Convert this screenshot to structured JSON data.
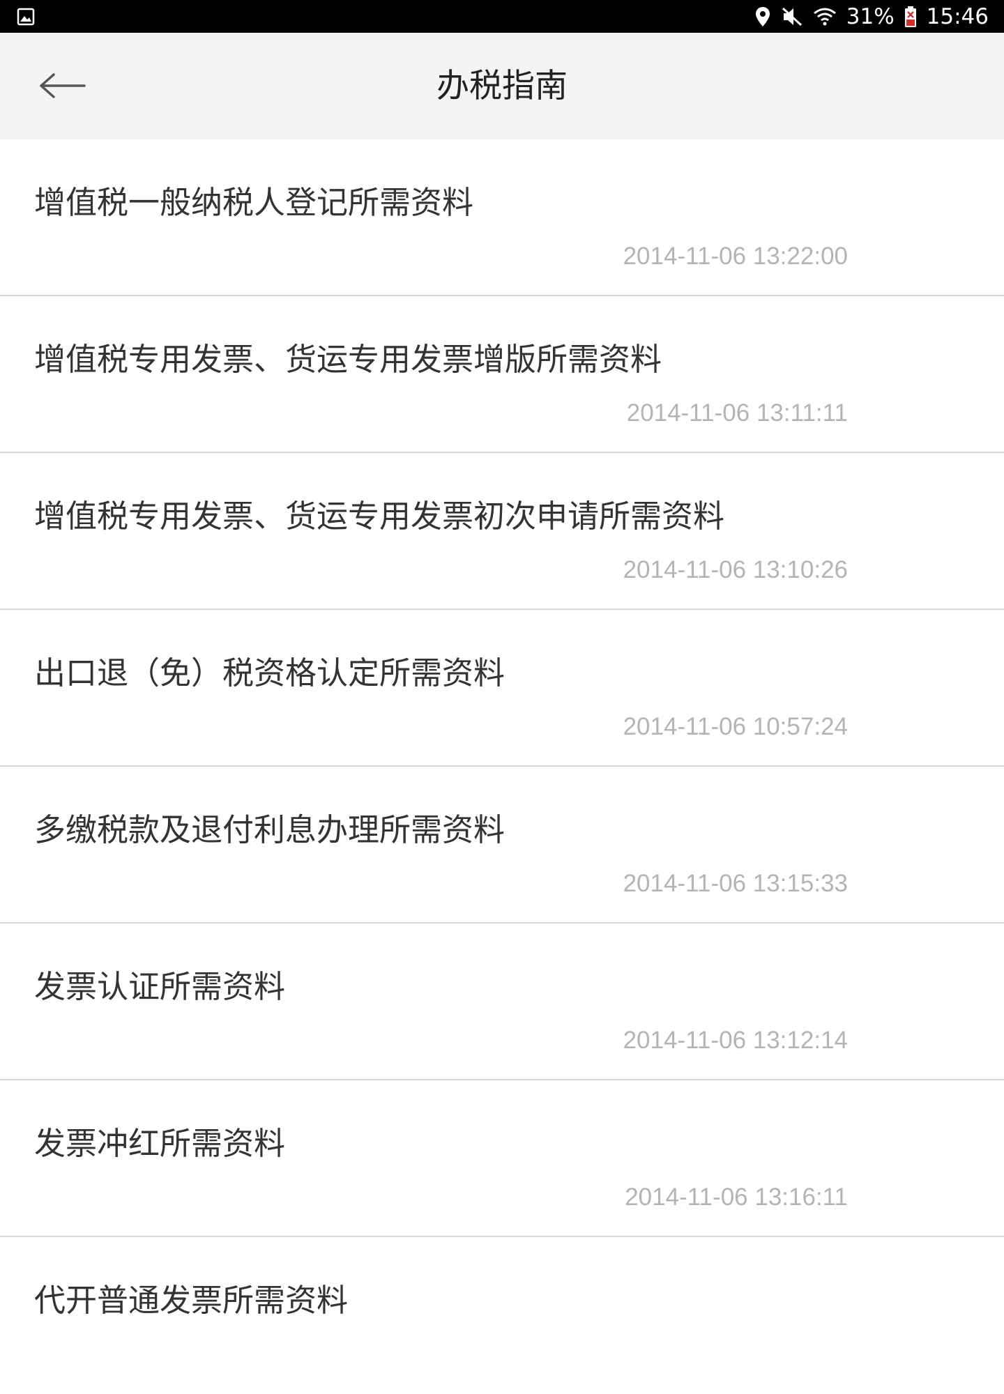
{
  "status_bar": {
    "left_icon": "image-notification-icon",
    "icons": [
      "location-icon",
      "mute-icon",
      "wifi-icon",
      "battery-icon"
    ],
    "battery_percent": "31%",
    "time": "15:46"
  },
  "header": {
    "back_icon": "arrow-left-icon",
    "title": "办税指南"
  },
  "list": {
    "items": [
      {
        "title": "增值税一般纳税人登记所需资料",
        "date": "2014-11-06 13:22:00"
      },
      {
        "title": "增值税专用发票、货运专用发票增版所需资料",
        "date": "2014-11-06 13:11:11"
      },
      {
        "title": "增值税专用发票、货运专用发票初次申请所需资料",
        "date": "2014-11-06 13:10:26"
      },
      {
        "title": "出口退（免）税资格认定所需资料",
        "date": "2014-11-06 10:57:24"
      },
      {
        "title": "多缴税款及退付利息办理所需资料",
        "date": "2014-11-06 13:15:33"
      },
      {
        "title": "发票认证所需资料",
        "date": "2014-11-06 13:12:14"
      },
      {
        "title": "发票冲红所需资料",
        "date": "2014-11-06 13:16:11"
      },
      {
        "title": "代开普通发票所需资料",
        "date": ""
      }
    ]
  },
  "colors": {
    "status_bar_bg": "#000000",
    "header_bg": "#f4f4f4",
    "title_text": "#222222",
    "item_text": "#333333",
    "date_text": "#b4b4b4",
    "divider": "#d8d8d8"
  }
}
